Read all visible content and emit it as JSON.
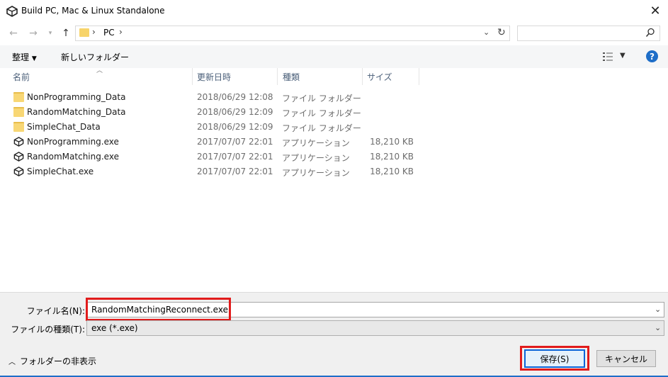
{
  "window": {
    "title": "Build PC, Mac & Linux Standalone",
    "close_glyph": "✕"
  },
  "address": {
    "segments": [
      "PC"
    ],
    "separator": "›",
    "search_placeholder": ""
  },
  "toolbar": {
    "organize": "整理",
    "new_folder": "新しいフォルダー",
    "help_glyph": "?"
  },
  "columns": {
    "name": "名前",
    "date": "更新日時",
    "type": "種類",
    "size": "サイズ"
  },
  "files": [
    {
      "name": "NonProgramming_Data",
      "date": "2018/06/29 12:08",
      "type": "ファイル フォルダー",
      "size": "",
      "icon": "folder-icon"
    },
    {
      "name": "RandomMatching_Data",
      "date": "2018/06/29 12:09",
      "type": "ファイル フォルダー",
      "size": "",
      "icon": "folder-icon"
    },
    {
      "name": "SimpleChat_Data",
      "date": "2018/06/29 12:09",
      "type": "ファイル フォルダー",
      "size": "",
      "icon": "folder-icon"
    },
    {
      "name": "NonProgramming.exe",
      "date": "2017/07/07 22:01",
      "type": "アプリケーション",
      "size": "18,210 KB",
      "icon": "unity-icon"
    },
    {
      "name": "RandomMatching.exe",
      "date": "2017/07/07 22:01",
      "type": "アプリケーション",
      "size": "18,210 KB",
      "icon": "unity-icon"
    },
    {
      "name": "SimpleChat.exe",
      "date": "2017/07/07 22:01",
      "type": "アプリケーション",
      "size": "18,210 KB",
      "icon": "unity-icon"
    }
  ],
  "form": {
    "filename_label": "ファイル名(N):",
    "filename_value": "RandomMatchingReconnect.exe",
    "filetype_label": "ファイルの種類(T):",
    "filetype_value": "exe (*.exe)"
  },
  "footer": {
    "hide_folders": "フォルダーの非表示",
    "save": "保存(S)",
    "cancel": "キャンセル"
  },
  "colors": {
    "accent": "#1e6ec8",
    "highlight": "#e11b1b",
    "folder": "#f8d775"
  }
}
